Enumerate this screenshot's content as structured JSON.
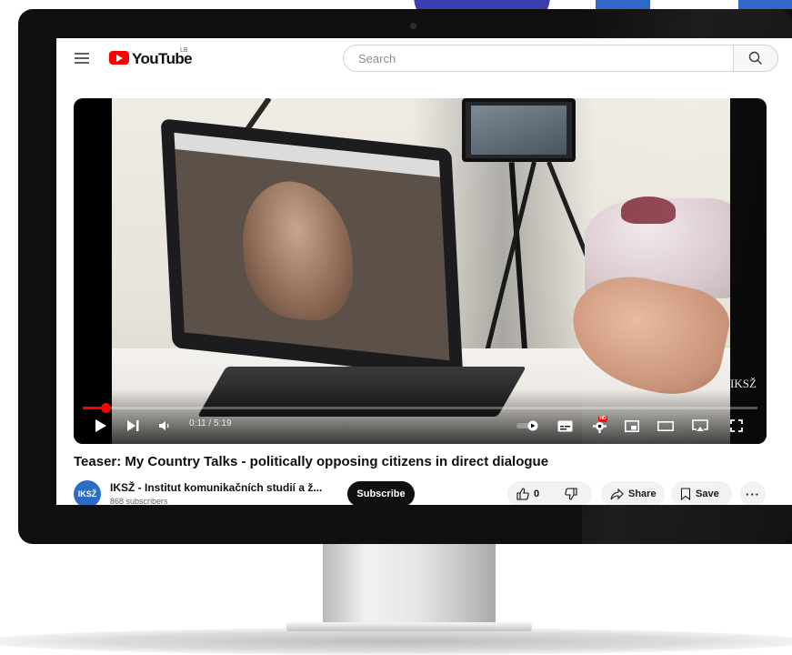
{
  "header": {
    "logo_text": "YouTube",
    "country_code": "LB",
    "search_placeholder": "Search"
  },
  "player": {
    "watermark": "IKSŽ",
    "current_time": "0:11",
    "duration": "5:19",
    "time_display": "0:11 / 5:19",
    "progress_fraction": 0.034,
    "hd_badge": "HD"
  },
  "video": {
    "title": "Teaser: My Country Talks - politically opposing citizens in direct dialogue"
  },
  "channel": {
    "avatar_text": "IKSŽ",
    "name": "IKSŽ - Institut komunikačních studií a ž...",
    "subscribers": "868 subscribers",
    "subscribe_label": "Subscribe"
  },
  "actions": {
    "like_count": "0",
    "share_label": "Share",
    "save_label": "Save",
    "more_label": "···"
  },
  "colors": {
    "accent": "#ff0000",
    "monitor_bezel": "#0f0f10",
    "deco_purple": "#3a3fb0",
    "deco_blue": "#2f68c8"
  }
}
